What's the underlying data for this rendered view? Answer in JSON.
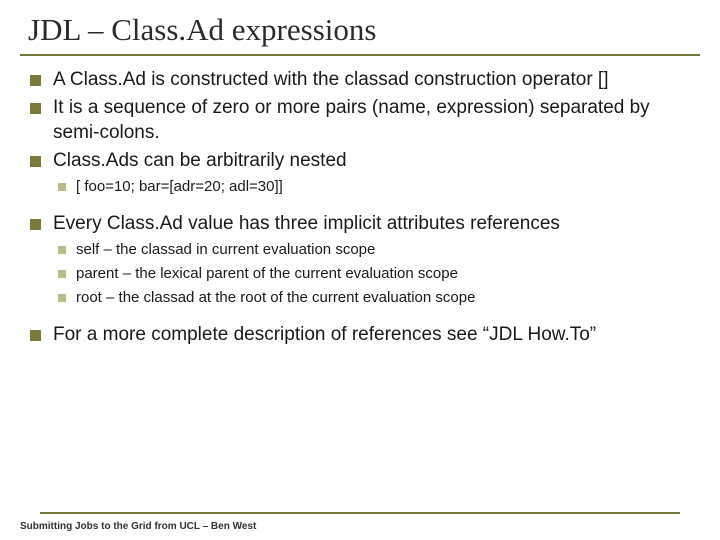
{
  "title": "JDL – Class.Ad expressions",
  "bullets": [
    {
      "level": 1,
      "text": "A Class.Ad is constructed with the classad construction operator []"
    },
    {
      "level": 1,
      "text": "It is a sequence of zero or more pairs (name, expression) separated by semi-colons."
    },
    {
      "level": 1,
      "text": "Class.Ads can be arbitrarily nested"
    },
    {
      "level": 2,
      "text": "[ foo=10; bar=[adr=20; adl=30]]"
    },
    {
      "level": 1,
      "text": "Every Class.Ad value has three implicit attributes references"
    },
    {
      "level": 2,
      "text": "self – the classad in current evaluation scope"
    },
    {
      "level": 2,
      "text": "parent – the lexical parent of the current evaluation scope"
    },
    {
      "level": 2,
      "text": "root – the classad at the root of the current evaluation scope"
    },
    {
      "level": 1,
      "text": "For a more complete description of references see “JDL How.To”"
    }
  ],
  "footer": "Submitting Jobs to the Grid from UCL – Ben West"
}
